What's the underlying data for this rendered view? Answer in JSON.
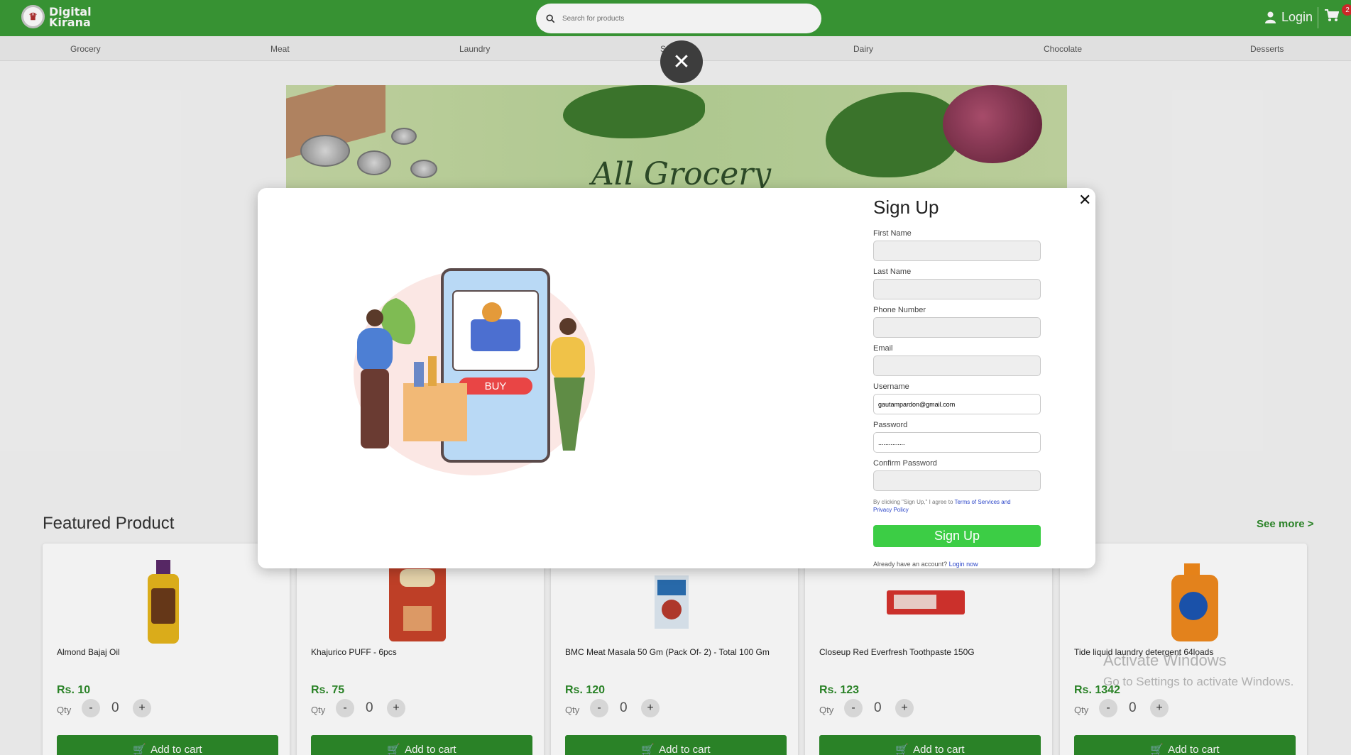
{
  "header": {
    "logo_line1": "Digital",
    "logo_line2": "Kirana",
    "search_placeholder": "Search for products",
    "login_label": "Login",
    "cart_count": "2"
  },
  "categories": [
    "Grocery",
    "Meat",
    "Laundry",
    "S",
    "Dairy",
    "Chocolate",
    "Desserts"
  ],
  "banner": {
    "title": "All Grocery"
  },
  "featured": {
    "title": "Featured Product",
    "see_more": "See more >",
    "qty_label": "Qty",
    "add_label": "Add to cart",
    "products": [
      {
        "name": "Almond Bajaj Oil",
        "price": "Rs. 10",
        "qty": "0"
      },
      {
        "name": "Khajurico PUFF - 6pcs",
        "price": "Rs. 75",
        "qty": "0"
      },
      {
        "name": "BMC Meat Masala 50 Gm (Pack Of- 2) - Total 100 Gm",
        "price": "Rs. 120",
        "qty": "0"
      },
      {
        "name": "Closeup Red Everfresh Toothpaste 150G",
        "price": "Rs. 123",
        "qty": "0"
      },
      {
        "name": "Tide liquid laundry detergent 64loads",
        "price": "Rs. 1342",
        "qty": "0"
      }
    ]
  },
  "modal": {
    "title": "Sign Up",
    "illustration_button": "BUY",
    "fields": {
      "first_name": {
        "label": "First Name",
        "value": ""
      },
      "last_name": {
        "label": "Last Name",
        "value": ""
      },
      "phone": {
        "label": "Phone Number",
        "value": ""
      },
      "email": {
        "label": "Email",
        "value": ""
      },
      "username": {
        "label": "Username",
        "value": "gautampardon@gmail.com"
      },
      "password": {
        "label": "Password",
        "value": "..............."
      },
      "confirm_password": {
        "label": "Confirm Password",
        "value": ""
      }
    },
    "terms_prefix": "By clicking \"Sign Up,\" I agree to ",
    "terms_link": "Terms of Services and Privacy Policy",
    "submit_label": "Sign Up",
    "already_text": "Already have an account? ",
    "login_link": "Login now"
  },
  "watermark": {
    "line1": "Activate Windows",
    "line2": "Go to Settings to activate Windows."
  },
  "colors": {
    "brand_green": "#3a9a36",
    "signup_green": "#3ccd45",
    "price_green": "#2d8a2a"
  }
}
